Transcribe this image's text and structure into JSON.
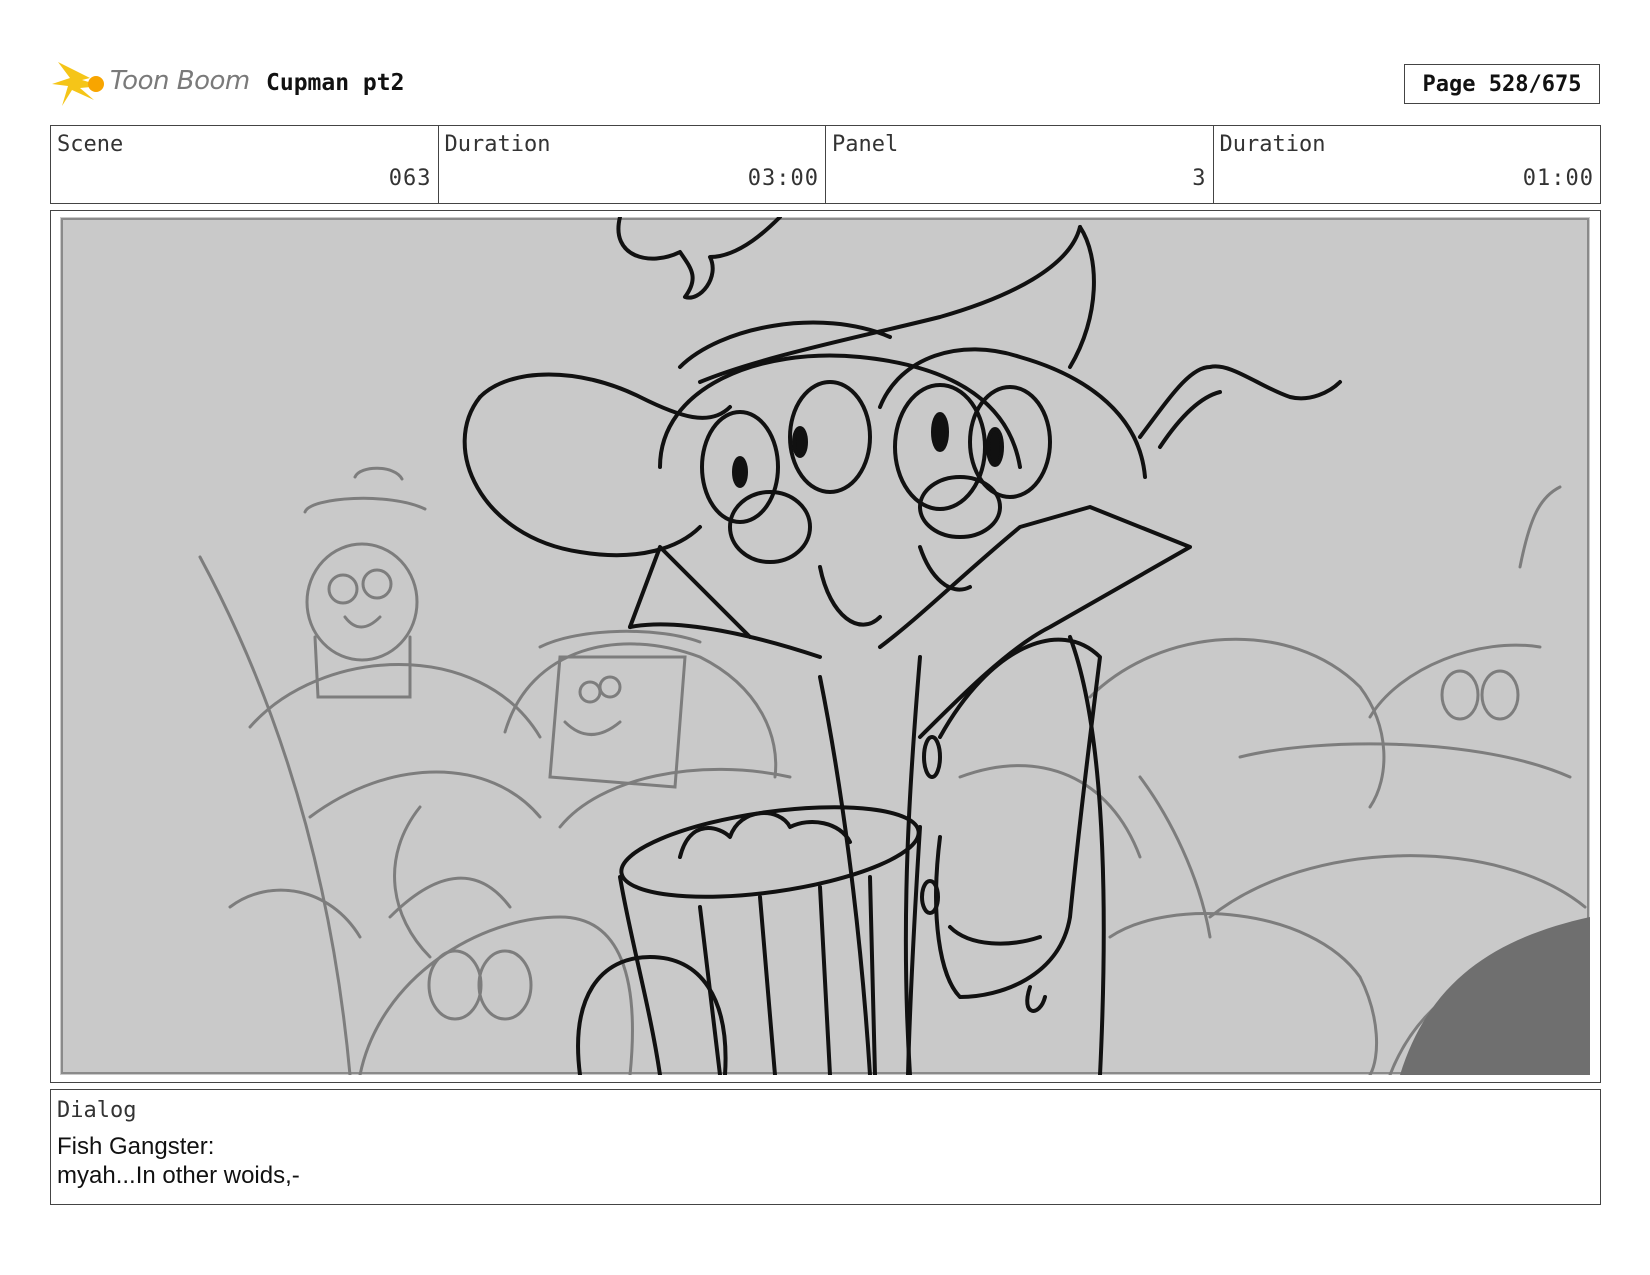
{
  "header": {
    "logo_text": "Toon Boom",
    "project_title": "Cupman pt2",
    "page": "Page 528/675"
  },
  "info": {
    "scene_label": "Scene",
    "scene_value": "063",
    "scene_duration_label": "Duration",
    "scene_duration_value": "03:00",
    "panel_label": "Panel",
    "panel_value": "3",
    "panel_duration_label": "Duration",
    "panel_duration_value": "01:00"
  },
  "panel": {
    "image_description_icon": "storyboard-sketch"
  },
  "dialog": {
    "label": "Dialog",
    "speaker": "Fish Gangster:",
    "line": "myah...In other woids,-"
  },
  "colors": {
    "logo_accent": "#f5c518",
    "panel_background": "#c9c9c9",
    "sketch_dark": "#111111",
    "sketch_light": "#7d7d7d"
  }
}
